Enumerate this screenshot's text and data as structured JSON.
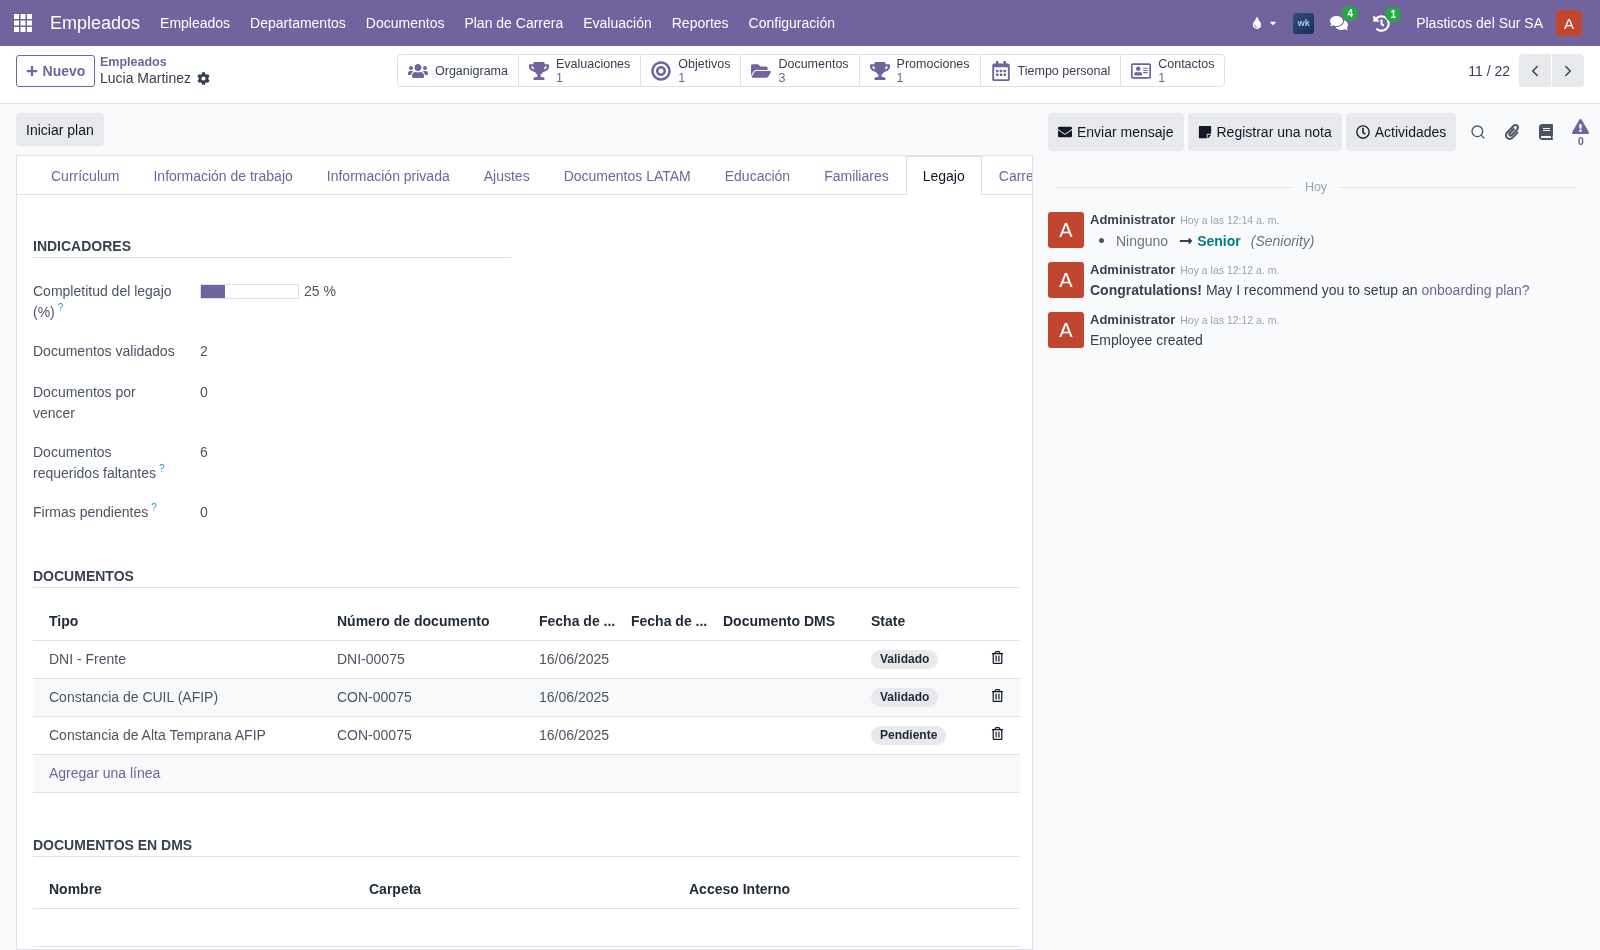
{
  "navbar": {
    "app_name": "Empleados",
    "menu": [
      "Empleados",
      "Departamentos",
      "Documentos",
      "Plan de Carrera",
      "Evaluación",
      "Reportes",
      "Configuración"
    ],
    "logo_text": "wk",
    "messages_badge": "4",
    "activities_badge": "1",
    "company": "Plasticos del Sur SA",
    "user_initial": "A"
  },
  "control_panel": {
    "new_button": "Nuevo",
    "breadcrumb": {
      "parent": "Empleados",
      "current": "Lucia Martinez"
    },
    "smart_buttons": [
      {
        "label": "Organigrama"
      },
      {
        "label": "Evaluaciones",
        "count": "1"
      },
      {
        "label": "Objetivos",
        "count": "1"
      },
      {
        "label": "Documentos",
        "count": "3"
      },
      {
        "label": "Promociones",
        "count": "1"
      },
      {
        "label": "Tiempo personal"
      },
      {
        "label": "Contactos",
        "count": "1"
      }
    ],
    "pager": "11 / 22"
  },
  "form": {
    "action_buttons": [
      "Iniciar plan"
    ],
    "tabs": [
      {
        "label": "Currículum",
        "selected": false
      },
      {
        "label": "Información de trabajo",
        "selected": false
      },
      {
        "label": "Información privada",
        "selected": false
      },
      {
        "label": "Ajustes",
        "selected": false
      },
      {
        "label": "Documentos LATAM",
        "selected": false
      },
      {
        "label": "Educación",
        "selected": false
      },
      {
        "label": "Familiares",
        "selected": false
      },
      {
        "label": "Legajo",
        "selected": true
      },
      {
        "label": "Carre",
        "selected": false
      }
    ],
    "indicators": {
      "title": "INDICADORES",
      "fields": [
        {
          "label": "Completitud del legajo (%)",
          "help": "?",
          "kind": "progress",
          "level": 0.25,
          "value": "25 %"
        },
        {
          "label": "Documentos validados",
          "kind": "value",
          "value": "2"
        },
        {
          "label": "Documentos por vencer",
          "kind": "value",
          "value": "0"
        },
        {
          "label": "Documentos requeridos faltantes",
          "help": "?",
          "kind": "value",
          "value": "6"
        },
        {
          "label": "Firmas pendientes",
          "help": "?",
          "kind": "value",
          "value": "0"
        }
      ]
    },
    "documents": {
      "title": "DOCUMENTOS",
      "columns": [
        "Tipo",
        "Número de documento",
        "Fecha de ...",
        "Fecha de ...",
        "Documento DMS",
        "State"
      ],
      "rows": [
        {
          "tipo": "DNI - Frente",
          "numero": "DNI-00075",
          "fecha": "16/06/2025",
          "state": "Validado"
        },
        {
          "tipo": "Constancia de CUIL (AFIP)",
          "numero": "CON-00075",
          "fecha": "16/06/2025",
          "state": "Validado"
        },
        {
          "tipo": "Constancia de Alta Temprana AFIP",
          "numero": "CON-00075",
          "fecha": "16/06/2025",
          "state": "Pendiente"
        }
      ],
      "add_line": "Agregar una línea"
    },
    "dms_documents": {
      "title": "DOCUMENTOS EN DMS",
      "columns": [
        "Nombre",
        "Carpeta",
        "Acceso Interno"
      ]
    }
  },
  "chatter": {
    "buttons": [
      "Enviar mensaje",
      "Registrar una nota",
      "Actividades"
    ],
    "alert_count": "0",
    "date_separator": "Hoy",
    "messages": [
      {
        "avatar": "A",
        "author": "Administrator",
        "date": "Hoy a las 12:14 a. m.",
        "kind": "tracking",
        "old_value": "Ninguno",
        "new_value": "Senior",
        "field": "(Seniority)"
      },
      {
        "avatar": "A",
        "author": "Administrator",
        "date": "Hoy a las 12:12 a. m.",
        "kind": "text_link",
        "text": "**Congratulations!** May I recommend you to setup an",
        "link": "onboarding plan?"
      },
      {
        "avatar": "A",
        "author": "Administrator",
        "date": "Hoy a las 12:12 a. m.",
        "kind": "text",
        "text": "Employee created"
      }
    ]
  }
}
